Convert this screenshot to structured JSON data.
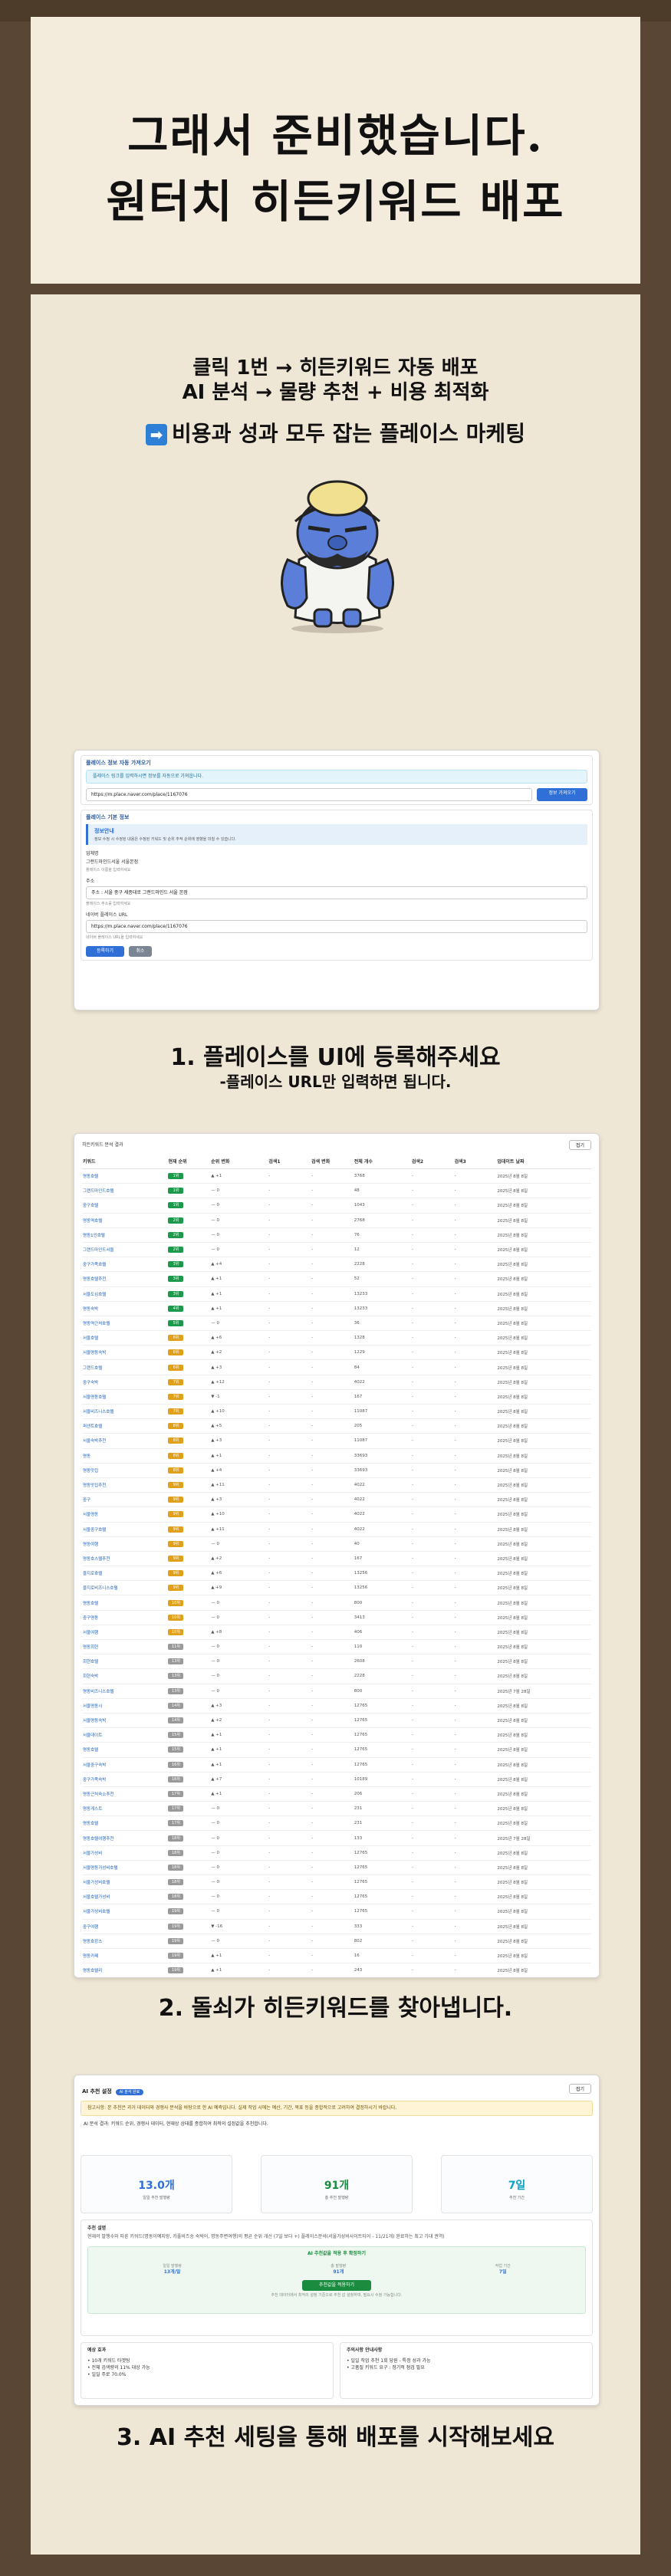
{
  "hero": {
    "line1": "그래서 준비했습니다.",
    "line2": "원터치 히든키워드 배포"
  },
  "intro": {
    "line1": "클릭 1번 → 히든키워드 자동 배포",
    "line2": "AI 분석 → 물량 추천 + 비용 최적화",
    "line3": "비용과 성과 모두 잡는 플레이스 마케팅",
    "arrow": "➡"
  },
  "step1": {
    "header": "플레이스 정보 자동 가져오기",
    "info": "플레이스 링크를 입력하시면 정보를 자동으로 가져옵니다.",
    "url_value": "https://m.place.naver.com/place/1167076",
    "fetch_button": "정보 가져오기",
    "basic_header": "플레이스 기본 정보",
    "notice_title": "정보안내",
    "notice_text": "정보 수정 시 수정된 내용은 수정된 키워드 및 순위 추적 순위에 영향을 미칠 수 있습니다.",
    "name_label": "업체명",
    "name_value": "그랜드마인드서울 서울본점",
    "name_help": "플레이스 이름을 입력하세요",
    "address_label": "주소",
    "address_value": "주소 : 서울 중구 세종대로 그랜드마인드 서울 본점",
    "address_help": "플레이스 주소를 입력하세요",
    "url_label": "네이버 플레이스 URL",
    "url_value2": "https://m.place.naver.com/place/1167076",
    "url_help": "네이버 플레이스 URL을 입력하세요",
    "save_button": "등록하기",
    "cancel_button": "취소"
  },
  "caption1": "1. 플레이스를 UI에 등록해주세요",
  "caption1_sub": "-플레이스 URL만 입력하면 됩니다.",
  "step2": {
    "title": "히든키워드 분석 결과",
    "collapse": "접기",
    "columns": [
      "키워드",
      "현재 순위",
      "순위 변화",
      "검색1",
      "검색 변화",
      "전체 개수",
      "검색2",
      "검색3",
      "업데이트 날짜"
    ],
    "rows": [
      {
        "k": "명동호텔",
        "r": "1위",
        "rc": "#1a9a4a",
        "d": "▲ +1",
        "dir": "up",
        "n": "3768",
        "dt": "2025년 8월 8일"
      },
      {
        "k": "그랜드마인드호텔",
        "r": "1위",
        "rc": "#1a9a4a",
        "d": "— 0",
        "dir": "",
        "n": "48",
        "dt": "2025년 8월 8일"
      },
      {
        "k": "중구호텔",
        "r": "1위",
        "rc": "#1a9a4a",
        "d": "— 0",
        "dir": "",
        "n": "1043",
        "dt": "2025년 8월 8일"
      },
      {
        "k": "명동역호텔",
        "r": "2위",
        "rc": "#1a9a4a",
        "d": "— 0",
        "dir": "",
        "n": "2768",
        "dt": "2025년 8월 8일"
      },
      {
        "k": "명동1인호텔",
        "r": "2위",
        "rc": "#1a9a4a",
        "d": "— 0",
        "dir": "",
        "n": "76",
        "dt": "2025년 8월 8일"
      },
      {
        "k": "그랜드마인드서울",
        "r": "2위",
        "rc": "#1a9a4a",
        "d": "— 0",
        "dir": "",
        "n": "12",
        "dt": "2025년 8월 8일"
      },
      {
        "k": "중구가족호텔",
        "r": "3위",
        "rc": "#1a9a4a",
        "d": "▲ +4",
        "dir": "up",
        "n": "2228",
        "dt": "2025년 8월 8일"
      },
      {
        "k": "명동호텔추천",
        "r": "3위",
        "rc": "#1a9a4a",
        "d": "▲ +1",
        "dir": "up",
        "n": "52",
        "dt": "2025년 8월 8일"
      },
      {
        "k": "서울도심호텔",
        "r": "3위",
        "rc": "#1a9a4a",
        "d": "▲ +1",
        "dir": "up",
        "n": "13233",
        "dt": "2025년 8월 8일"
      },
      {
        "k": "명동숙박",
        "r": "4위",
        "rc": "#1a9a4a",
        "d": "▲ +1",
        "dir": "up",
        "n": "13233",
        "dt": "2025년 8월 8일"
      },
      {
        "k": "명동역근처호텔",
        "r": "5위",
        "rc": "#1a9a4a",
        "d": "— 0",
        "dir": "",
        "n": "36",
        "dt": "2025년 8월 8일"
      },
      {
        "k": "서울호텔",
        "r": "6위",
        "rc": "#e0a01a",
        "d": "▲ +6",
        "dir": "up",
        "n": "1328",
        "dt": "2025년 8월 8일"
      },
      {
        "k": "서울명동숙박",
        "r": "6위",
        "rc": "#e0a01a",
        "d": "▲ +2",
        "dir": "up",
        "n": "1229",
        "dt": "2025년 8월 8일"
      },
      {
        "k": "그랜드호텔",
        "r": "6위",
        "rc": "#e0a01a",
        "d": "▲ +3",
        "dir": "up",
        "n": "84",
        "dt": "2025년 8월 8일"
      },
      {
        "k": "중구숙박",
        "r": "7위",
        "rc": "#e0a01a",
        "d": "▲ +12",
        "dir": "up",
        "n": "4022",
        "dt": "2025년 8월 8일"
      },
      {
        "k": "서울명동호텔",
        "r": "7위",
        "rc": "#e0a01a",
        "d": "▼ -1",
        "dir": "dn",
        "n": "167",
        "dt": "2025년 8월 8일"
      },
      {
        "k": "서울비즈니스호텔",
        "r": "7위",
        "rc": "#e0a01a",
        "d": "▲ +10",
        "dir": "up",
        "n": "11087",
        "dt": "2025년 8월 8일"
      },
      {
        "k": "퍼센트호텔",
        "r": "8위",
        "rc": "#e0a01a",
        "d": "▲ +5",
        "dir": "up",
        "n": "205",
        "dt": "2025년 8월 8일"
      },
      {
        "k": "서울숙박추천",
        "r": "8위",
        "rc": "#e0a01a",
        "d": "▲ +3",
        "dir": "up",
        "n": "11087",
        "dt": "2025년 8월 8일"
      },
      {
        "k": "명동",
        "r": "8위",
        "rc": "#e0a01a",
        "d": "▲ +1",
        "dir": "up",
        "n": "33693",
        "dt": "2025년 8월 8일"
      },
      {
        "k": "명동맛집",
        "r": "8위",
        "rc": "#e0a01a",
        "d": "▲ +4",
        "dir": "up",
        "n": "33693",
        "dt": "2025년 8월 8일"
      },
      {
        "k": "명동맛집추천",
        "r": "9위",
        "rc": "#e0a01a",
        "d": "▲ +11",
        "dir": "up",
        "n": "4022",
        "dt": "2025년 8월 8일"
      },
      {
        "k": "중구",
        "r": "9위",
        "rc": "#e0a01a",
        "d": "▲ +3",
        "dir": "up",
        "n": "4022",
        "dt": "2025년 8월 8일"
      },
      {
        "k": "서울명동",
        "r": "9위",
        "rc": "#e0a01a",
        "d": "▲ +10",
        "dir": "up",
        "n": "4022",
        "dt": "2025년 8월 8일"
      },
      {
        "k": "서울중구호텔",
        "r": "9위",
        "rc": "#e0a01a",
        "d": "▲ +11",
        "dir": "up",
        "n": "4022",
        "dt": "2025년 8월 8일"
      },
      {
        "k": "명동여행",
        "r": "9위",
        "rc": "#e0a01a",
        "d": "— 0",
        "dir": "",
        "n": "40",
        "dt": "2025년 8월 8일"
      },
      {
        "k": "명동호스텔추천",
        "r": "9위",
        "rc": "#e0a01a",
        "d": "▲ +2",
        "dir": "up",
        "n": "167",
        "dt": "2025년 8월 8일"
      },
      {
        "k": "을지로호텔",
        "r": "9위",
        "rc": "#e0a01a",
        "d": "▲ +6",
        "dir": "up",
        "n": "13256",
        "dt": "2025년 8월 8일"
      },
      {
        "k": "을지로비즈니스호텔",
        "r": "9위",
        "rc": "#e0a01a",
        "d": "▲ +9",
        "dir": "up",
        "n": "13256",
        "dt": "2025년 8월 8일"
      },
      {
        "k": "명동호텔",
        "r": "10위",
        "rc": "#e0a01a",
        "d": "— 0",
        "dir": "",
        "n": "800",
        "dt": "2025년 8월 8일"
      },
      {
        "k": "중구명동",
        "r": "10위",
        "rc": "#e0a01a",
        "d": "— 0",
        "dir": "",
        "n": "3413",
        "dt": "2025년 8월 8일"
      },
      {
        "k": "서울여행",
        "r": "10위",
        "rc": "#e0a01a",
        "d": "▲ +8",
        "dir": "up",
        "n": "406",
        "dt": "2025년 8월 8일"
      },
      {
        "k": "명동회현",
        "r": "11위",
        "rc": "#999",
        "d": "— 0",
        "dir": "",
        "n": "110",
        "dt": "2025년 8월 8일"
      },
      {
        "k": "회현호텔",
        "r": "13위",
        "rc": "#999",
        "d": "— 0",
        "dir": "",
        "n": "2608",
        "dt": "2025년 8월 8일"
      },
      {
        "k": "회현숙박",
        "r": "13위",
        "rc": "#999",
        "d": "— 0",
        "dir": "",
        "n": "2228",
        "dt": "2025년 8월 8일"
      },
      {
        "k": "명동비즈니스호텔",
        "r": "13위",
        "rc": "#999",
        "d": "— 0",
        "dir": "",
        "n": "800",
        "dt": "2025년 7월 28일"
      },
      {
        "k": "서울명동시",
        "r": "14위",
        "rc": "#999",
        "d": "▲ +3",
        "dir": "up",
        "n": "12765",
        "dt": "2025년 8월 8일"
      },
      {
        "k": "서울명동숙박",
        "r": "14위",
        "rc": "#999",
        "d": "▲ +2",
        "dir": "up",
        "n": "12765",
        "dt": "2025년 8월 8일"
      },
      {
        "k": "서울데이트",
        "r": "15위",
        "rc": "#999",
        "d": "▲ +1",
        "dir": "up",
        "n": "12765",
        "dt": "2025년 8월 8일"
      },
      {
        "k": "명동호텔",
        "r": "15위",
        "rc": "#999",
        "d": "▲ +1",
        "dir": "up",
        "n": "12765",
        "dt": "2025년 8월 8일"
      },
      {
        "k": "서울중구숙박",
        "r": "16위",
        "rc": "#999",
        "d": "▲ +1",
        "dir": "up",
        "n": "12765",
        "dt": "2025년 8월 8일"
      },
      {
        "k": "중구가족숙박",
        "r": "16위",
        "rc": "#999",
        "d": "▲ +7",
        "dir": "up",
        "n": "10189",
        "dt": "2025년 8월 8일"
      },
      {
        "k": "명동근처숙소추천",
        "r": "17위",
        "rc": "#999",
        "d": "▲ +1",
        "dir": "up",
        "n": "206",
        "dt": "2025년 8월 8일"
      },
      {
        "k": "명동게스트",
        "r": "17위",
        "rc": "#999",
        "d": "— 0",
        "dir": "",
        "n": "231",
        "dt": "2025년 8월 8일"
      },
      {
        "k": "명동호텔",
        "r": "17위",
        "rc": "#999",
        "d": "— 0",
        "dir": "",
        "n": "231",
        "dt": "2025년 8월 8일"
      },
      {
        "k": "명동호텔여행추천",
        "r": "18위",
        "rc": "#999",
        "d": "— 0",
        "dir": "",
        "n": "133",
        "dt": "2025년 7월 28일"
      },
      {
        "k": "서울가성비",
        "r": "18위",
        "rc": "#999",
        "d": "— 0",
        "dir": "",
        "n": "12765",
        "dt": "2025년 8월 8일"
      },
      {
        "k": "서울명동가성비호텔",
        "r": "18위",
        "rc": "#999",
        "d": "— 0",
        "dir": "",
        "n": "12765",
        "dt": "2025년 8월 8일"
      },
      {
        "k": "서울가성비호텔",
        "r": "18위",
        "rc": "#999",
        "d": "— 0",
        "dir": "",
        "n": "12765",
        "dt": "2025년 8월 8일"
      },
      {
        "k": "서울호텔가성비",
        "r": "18위",
        "rc": "#999",
        "d": "— 0",
        "dir": "",
        "n": "12765",
        "dt": "2025년 8월 8일"
      },
      {
        "k": "서울가성비호텔",
        "r": "19위",
        "rc": "#999",
        "d": "— 0",
        "dir": "",
        "n": "12765",
        "dt": "2025년 8월 8일"
      },
      {
        "k": "중구여행",
        "r": "19위",
        "rc": "#999",
        "d": "▼ -16",
        "dir": "dn",
        "n": "333",
        "dt": "2025년 8월 8일"
      },
      {
        "k": "명동호캉스",
        "r": "19위",
        "rc": "#999",
        "d": "— 0",
        "dir": "",
        "n": "802",
        "dt": "2025년 8월 8일"
      },
      {
        "k": "명동카페",
        "r": "19위",
        "rc": "#999",
        "d": "▲ +1",
        "dir": "up",
        "n": "16",
        "dt": "2025년 8월 8일"
      },
      {
        "k": "명동호텔리",
        "r": "19위",
        "rc": "#999",
        "d": "▲ +1",
        "dir": "up",
        "n": "243",
        "dt": "2025년 8월 8일"
      },
      {
        "k": "서울중구업소",
        "r": "19위",
        "rc": "#999",
        "d": "▲ +1",
        "dir": "up",
        "n": "243",
        "dt": "2025년 8월 8일"
      },
      {
        "k": "중구자유",
        "r": "19위",
        "rc": "#999",
        "d": "— 0",
        "dir": "",
        "n": "5563",
        "dt": "2025년 8월 8일"
      },
      {
        "k": "메이명동",
        "r": "19위",
        "rc": "#999",
        "d": "— 0",
        "dir": "",
        "n": "5558",
        "dt": "2025년 7월 28일"
      },
      {
        "k": "명동중심호텔",
        "r": "20위",
        "rc": "#999",
        "d": "▼ -1",
        "dir": "dn",
        "n": "113",
        "dt": "2025년 8월 8일"
      },
      {
        "k": "명동호텔추천",
        "r": "20위",
        "rc": "#999",
        "d": "— 0",
        "dir": "",
        "n": "523",
        "dt": "2025년 8월 8일"
      }
    ]
  },
  "caption2": "2. 돌쇠가 히든키워드를 찾아냅니다.",
  "step3": {
    "title": "AI 추천 설정",
    "badge": "AI 분석 완료",
    "collapse": "접기",
    "warning": "참고사항: 본 추천은 과거 데이터와 경쟁사 분석을 바탕으로 한 AI 예측입니다. 실제 작업 시에는 예산, 기간, 목표 등을 종합적으로 고려하여 결정하시기 바랍니다.",
    "analysis": "AI 분석 결과: 키워드 순위, 경쟁사 데이터, 현재상 상태를 종합하여 최적의 설정값을 추천합니다.",
    "stats": [
      {
        "value": "13.0개",
        "sub": "일일 추천 발행량",
        "color": "#2f6fd6"
      },
      {
        "value": "91개",
        "sub": "총 추천 발행량",
        "color": "#1b8c3f"
      },
      {
        "value": "7일",
        "sub": "추천 기간",
        "color": "#0aa0c8"
      }
    ],
    "rec_title": "추천 설명",
    "rec_text": "현재의 발행수와 따른 키워드(명동이예지랑, 카풀비즈송 숙박어, 명동주변여행)의 평균 순위 개선 (7일 보다 +) 플레이스분석(서울가성비사이트티어 - 11/21개) 완료하는 최고 기대 권역)",
    "apply_title": "AI 추천값을 적용 후 확정하기",
    "mini": [
      {
        "label": "일일 발행량",
        "value": "13개/일"
      },
      {
        "label": "총 발행량",
        "value": "91개"
      },
      {
        "label": "작업 기간",
        "value": "7일"
      }
    ],
    "apply_button": "추천값을 적용하기",
    "apply_help": "추천 데이터에서 최적의 설정 기준으로 추천 값 설정하며, 필요시 수정 가능합니다.",
    "expect_title": "예상 효과",
    "expect_items": [
      "10개 키워드 타겟팅",
      "전체 검색량의 11% 대상 가능",
      "일일 주로 70.0%"
    ],
    "policy_title": "주의사항 안내사항",
    "policy_items": [
      "일일 작업 추천 1회 당원 - 특정 성과 가능",
      "고품질 키워드 요구 : 정기적 점검 필요"
    ]
  },
  "caption3": "3. AI 추천 세팅을 통해 배포를 시작해보세요"
}
